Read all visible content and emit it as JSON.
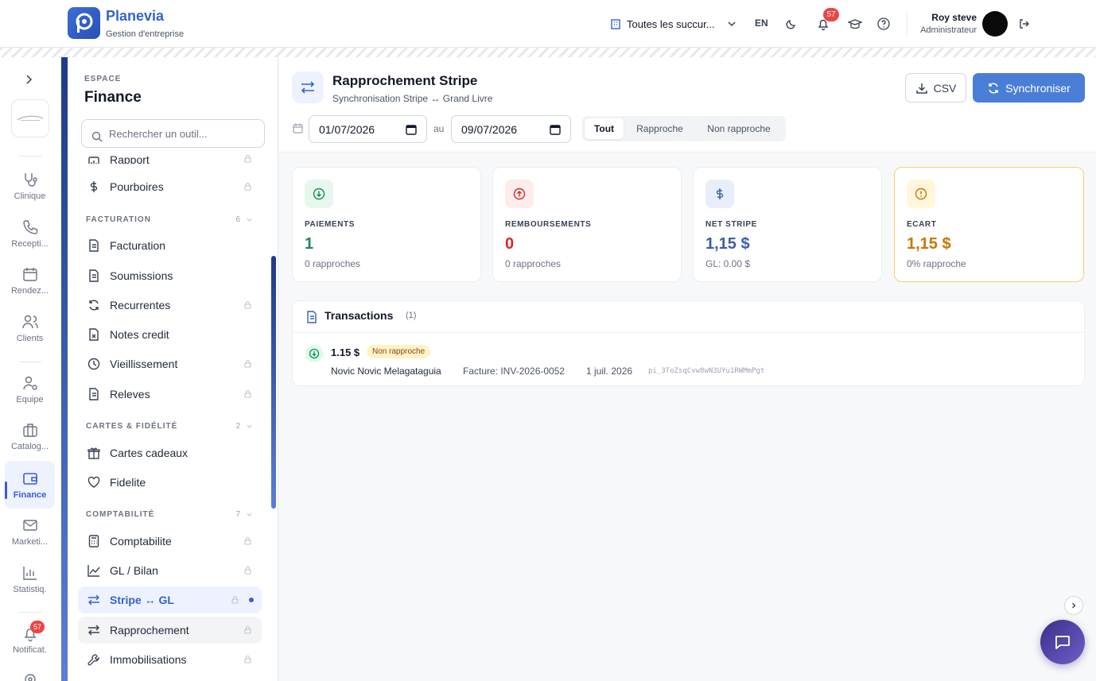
{
  "header": {
    "app_name": "Planevia",
    "app_subtitle": "Gestion d'entreprise",
    "branch_selector": "Toutes les succur...",
    "language": "EN",
    "notifications_count": "57",
    "user_name": "Roy steve",
    "user_role": "Administrateur"
  },
  "rail": {
    "items": [
      {
        "label": "Clinique",
        "icon": "stethoscope-icon"
      },
      {
        "label": "Recepti...",
        "icon": "phone-icon"
      },
      {
        "label": "Rendez...",
        "icon": "calendar-icon"
      },
      {
        "label": "Clients",
        "icon": "users-icon"
      },
      {
        "label": "Equipe",
        "icon": "user-gear-icon"
      },
      {
        "label": "Catalog...",
        "icon": "briefcase-icon"
      },
      {
        "label": "Finance",
        "icon": "wallet-icon"
      },
      {
        "label": "Marketi...",
        "icon": "mail-icon"
      },
      {
        "label": "Statistiq.",
        "icon": "bar-chart-icon"
      },
      {
        "label": "Notificat.",
        "icon": "bell-icon"
      }
    ],
    "notifications_count": "57",
    "active": "Finance"
  },
  "sidebar": {
    "kicker": "ESPACE",
    "title": "Finance",
    "search_placeholder": "Rechercher un outil...",
    "items_top": [
      {
        "label": "Rapport",
        "icon": "report-icon",
        "locked": true
      },
      {
        "label": "Pourboires",
        "icon": "dollar-icon",
        "locked": true
      }
    ],
    "groups": [
      {
        "label": "FACTURATION",
        "count": "6",
        "items": [
          {
            "label": "Facturation",
            "icon": "document-icon",
            "locked": false
          },
          {
            "label": "Soumissions",
            "icon": "document-icon",
            "locked": false
          },
          {
            "label": "Recurrentes",
            "icon": "refresh-icon",
            "locked": true
          },
          {
            "label": "Notes credit",
            "icon": "file-x-icon",
            "locked": false
          },
          {
            "label": "Vieillissement",
            "icon": "clock-icon",
            "locked": true
          },
          {
            "label": "Releves",
            "icon": "document-icon",
            "locked": true
          }
        ]
      },
      {
        "label": "CARTES & FIDÉLITÉ",
        "count": "2",
        "items": [
          {
            "label": "Cartes cadeaux",
            "icon": "gift-icon",
            "locked": false
          },
          {
            "label": "Fidelite",
            "icon": "heart-icon",
            "locked": false
          }
        ]
      },
      {
        "label": "COMPTABILITÉ",
        "count": "7",
        "items": [
          {
            "label": "Comptabilite",
            "icon": "calculator-icon",
            "locked": true
          },
          {
            "label": "GL / Bilan",
            "icon": "line-chart-icon",
            "locked": true
          },
          {
            "label": "Stripe ↔ GL",
            "icon": "arrows-swap-icon",
            "locked": true
          },
          {
            "label": "Rapprochement",
            "icon": "arrows-swap-icon",
            "locked": true
          },
          {
            "label": "Immobilisations",
            "icon": "wrench-icon",
            "locked": true
          }
        ]
      }
    ]
  },
  "page": {
    "title": "Rapprochement Stripe",
    "subtitle": "Synchronisation Stripe ↔ Grand Livre",
    "csv_label": "CSV",
    "sync_label": "Synchroniser",
    "date_from": "01/07/2026",
    "date_sep": "au",
    "date_to": "09/07/2026",
    "filters": [
      "Tout",
      "Rapproche",
      "Non rapproche"
    ],
    "selected_filter": "Tout"
  },
  "cards": [
    {
      "label": "PAIEMENTS",
      "value": "1",
      "sub": "0 rapproches",
      "color": "#1a8a5a",
      "icon": "arrow-down-circle-icon"
    },
    {
      "label": "REMBOURSEMENTS",
      "value": "0",
      "sub": "0 rapproches",
      "color": "#d62828",
      "icon": "arrow-up-circle-icon"
    },
    {
      "label": "NET STRIPE",
      "value": "1,15 $",
      "sub": "GL: 0.00 $",
      "color": "#3b5fa8",
      "icon": "dollar-icon"
    },
    {
      "label": "ECART",
      "value": "1,15 $",
      "sub": "0% rapproche",
      "color": "#c77700",
      "icon": "alert-circle-icon"
    }
  ],
  "transactions": {
    "title": "Transactions",
    "count": "(1)",
    "rows": [
      {
        "amount": "1.15 $",
        "status": "Non rapproche",
        "client": "Novic Novic Melagataguia",
        "invoice": "Facture: INV-2026-0052",
        "date": "1 juil. 2026",
        "stripe_id": "pi_3ToZsqCvw8wN3UYu1RWMmPgt"
      }
    ]
  }
}
